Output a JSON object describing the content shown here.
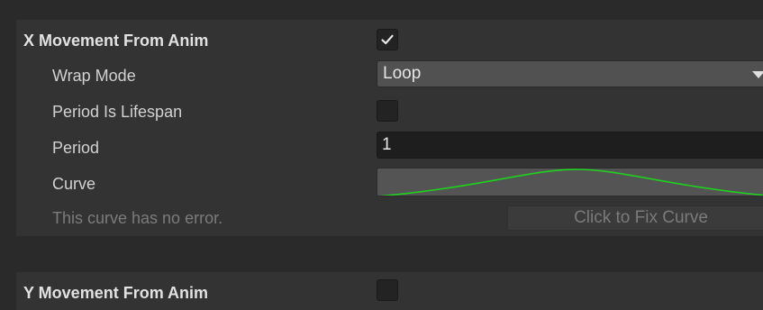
{
  "x_movement": {
    "title": "X Movement From Anim",
    "enabled": true,
    "wrap_mode": {
      "label": "Wrap Mode",
      "value": "Loop"
    },
    "period_is_lifespan": {
      "label": "Period Is Lifespan",
      "checked": false
    },
    "period": {
      "label": "Period",
      "value": "1"
    },
    "curve": {
      "label": "Curve",
      "curve_color": "#1fd11f"
    },
    "status_text": "This curve has no error.",
    "fix_button_label": "Click to Fix Curve"
  },
  "y_movement": {
    "title": "Y Movement From Anim",
    "enabled": false
  },
  "icons": {
    "checkmark": "checkmark-icon",
    "dropdown_arrow": "triangle-down-icon"
  },
  "colors": {
    "panel_bg": "#333333",
    "gap_bg": "#2a2a2a",
    "field_bg": "#1e1e1e",
    "dropdown_bg": "#515151",
    "muted_text": "#7b7b7b"
  }
}
